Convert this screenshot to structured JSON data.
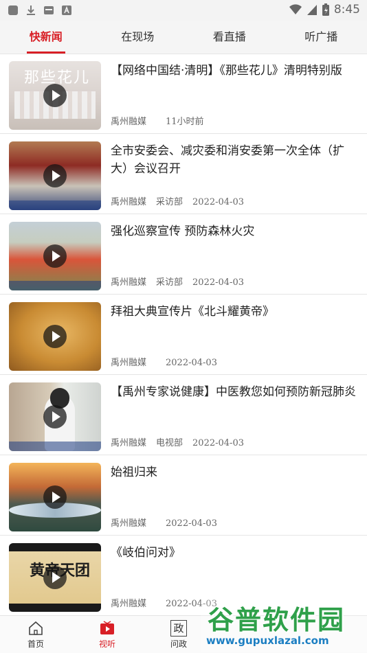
{
  "status_bar": {
    "time": "8:45",
    "icons": [
      "app-square-icon",
      "download-icon",
      "media-icon",
      "text-a-icon",
      "wifi-icon",
      "signal-icon",
      "battery-icon"
    ]
  },
  "tabs": [
    {
      "label": "快新闻",
      "active": true
    },
    {
      "label": "在现场",
      "active": false
    },
    {
      "label": "看直播",
      "active": false
    },
    {
      "label": "听广播",
      "active": false
    }
  ],
  "news": [
    {
      "title": "【网络中国结·清明】《那些花儿》清明特别版",
      "source": "禹州融媒",
      "dept": "",
      "time": "11小时前",
      "thumb_text": "那些花儿"
    },
    {
      "title": "全市安委会、减灾委和消安委第一次全体（扩大）会议召开",
      "source": "禹州融媒",
      "dept": "采访部",
      "time": "2022-04-03",
      "thumb_text": ""
    },
    {
      "title": "强化巡察宣传  预防森林火灾",
      "source": "禹州融媒",
      "dept": "采访部",
      "time": "2022-04-03",
      "thumb_text": ""
    },
    {
      "title": "拜祖大典宣传片《北斗耀黄帝》",
      "source": "禹州融媒",
      "dept": "",
      "time": "2022-04-03",
      "thumb_text": ""
    },
    {
      "title": "【禹州专家说健康】中医教您如何预防新冠肺炎",
      "source": "禹州融媒",
      "dept": "电视部",
      "time": "2022-04-03",
      "thumb_text": ""
    },
    {
      "title": "始祖归来",
      "source": "禹州融媒",
      "dept": "",
      "time": "2022-04-03",
      "thumb_text": ""
    },
    {
      "title": "《岐伯问对》",
      "source": "禹州融媒",
      "dept": "",
      "time": "2022-04-03",
      "thumb_text": "黄帝天团"
    }
  ],
  "bottom_nav": [
    {
      "label": "首页",
      "icon": "home-icon",
      "active": false
    },
    {
      "label": "视听",
      "icon": "video-play-icon",
      "active": true
    },
    {
      "label": "问政",
      "icon": "zheng-icon",
      "active": false,
      "glyph": "政"
    }
  ],
  "watermark": {
    "title": "谷普软件园",
    "url": "www.gupuxlazal.com"
  },
  "colors": {
    "accent": "#d81f26",
    "watermark_green": "#2fa04a",
    "watermark_blue": "#1b7ec2"
  }
}
